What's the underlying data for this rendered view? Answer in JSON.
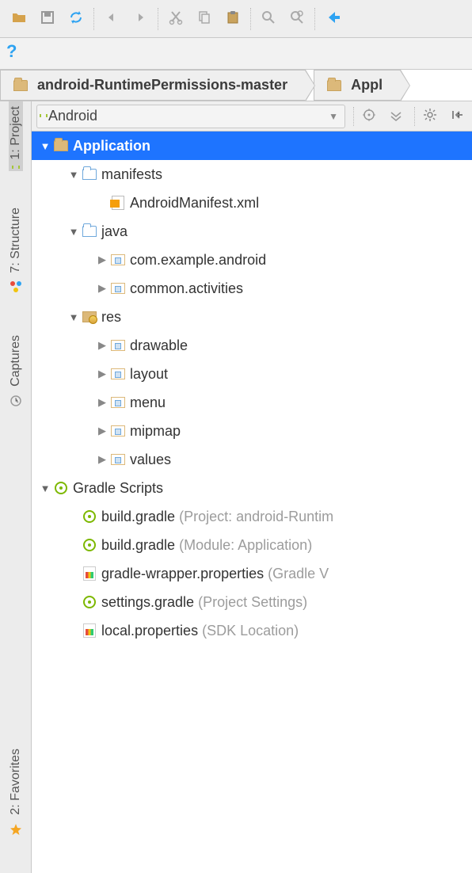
{
  "toolbar": {
    "icons": [
      "folder",
      "save",
      "sync",
      "undo",
      "redo",
      "cut",
      "copy",
      "paste",
      "find",
      "find-usages",
      "back"
    ]
  },
  "help": {
    "symbol": "?"
  },
  "breadcrumb": {
    "items": [
      {
        "label": "android-RuntimePermissions-master"
      },
      {
        "label": "Appl"
      }
    ]
  },
  "side": {
    "project": "1: Project",
    "structure": "7: Structure",
    "captures": "Captures",
    "favorites": "2: Favorites"
  },
  "panel": {
    "dropdown": "Android"
  },
  "tree": {
    "app": {
      "label": "Application",
      "manifests": {
        "label": "manifests",
        "file": "AndroidManifest.xml"
      },
      "java": {
        "label": "java",
        "pkg1": "com.example.android",
        "pkg2": "common.activities"
      },
      "res": {
        "label": "res",
        "d1": "drawable",
        "d2": "layout",
        "d3": "menu",
        "d4": "mipmap",
        "d5": "values"
      }
    },
    "gradle": {
      "label": "Gradle Scripts",
      "files": [
        {
          "name": "build.gradle",
          "hint": "(Project: android-Runtim"
        },
        {
          "name": "build.gradle",
          "hint": "(Module: Application)"
        },
        {
          "name": "gradle-wrapper.properties",
          "hint": "(Gradle V"
        },
        {
          "name": "settings.gradle",
          "hint": "(Project Settings)"
        },
        {
          "name": "local.properties",
          "hint": "(SDK Location)"
        }
      ]
    }
  }
}
